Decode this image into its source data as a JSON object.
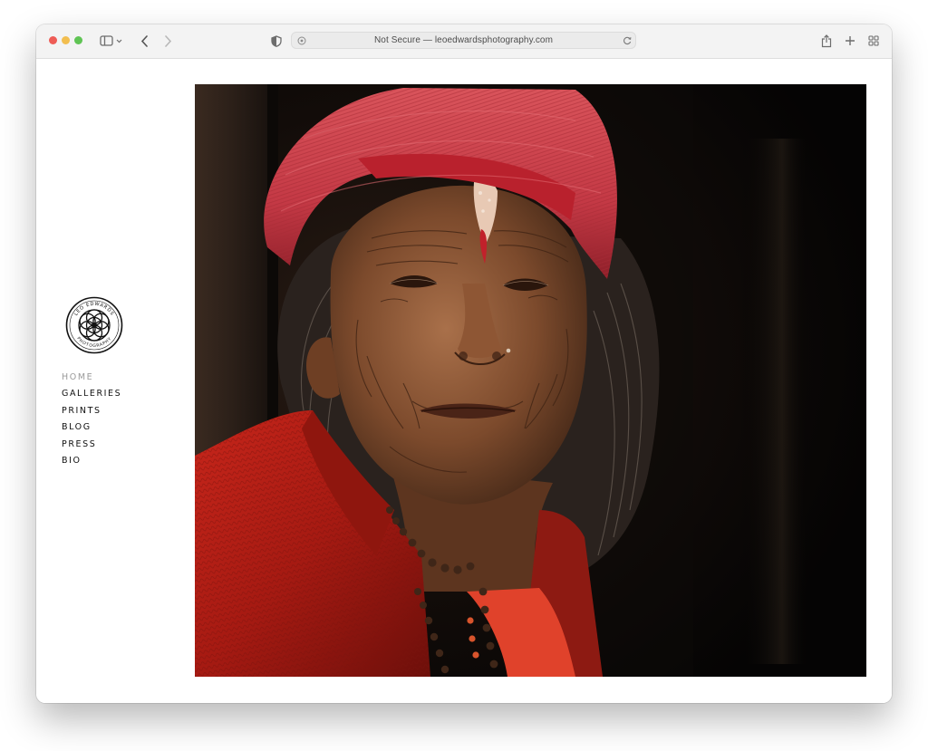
{
  "browser": {
    "address_text": "Not Secure — leoedwardsphotography.com"
  },
  "site": {
    "logo_text": "LEO EDWARDS PHOTOGRAPHY"
  },
  "nav": {
    "items": [
      {
        "label": "HOME",
        "active": true
      },
      {
        "label": "GALLERIES",
        "active": false
      },
      {
        "label": "PRINTS",
        "active": false
      },
      {
        "label": "BLOG",
        "active": false
      },
      {
        "label": "PRESS",
        "active": false
      },
      {
        "label": "BIO",
        "active": false
      }
    ]
  },
  "colors": {
    "nav_active": "#9a9a9a",
    "nav_text": "#111111"
  }
}
